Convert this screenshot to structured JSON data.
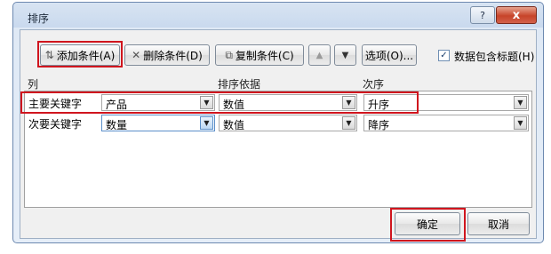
{
  "window": {
    "title": "排序",
    "help_label": "?",
    "close_label": "x"
  },
  "toolbar": {
    "add_level_label": "添加条件(A)",
    "delete_level_label": "删除条件(D)",
    "copy_level_label": "复制条件(C)",
    "move_up_label": "▲",
    "move_down_label": "▼",
    "options_label": "选项(O)...",
    "header_checkbox_label": "数据包含标题(H)",
    "header_checkbox_checked": true
  },
  "columns": {
    "column": "列",
    "sort_on": "排序依据",
    "order": "次序"
  },
  "rows": [
    {
      "label": "主要关键字",
      "column": "产品",
      "sort_on": "数值",
      "order": "升序"
    },
    {
      "label": "次要关键字",
      "column": "数量",
      "sort_on": "数值",
      "order": "降序"
    }
  ],
  "footer": {
    "ok_label": "确定",
    "cancel_label": "取消"
  },
  "highlight_color": "#d0151e"
}
